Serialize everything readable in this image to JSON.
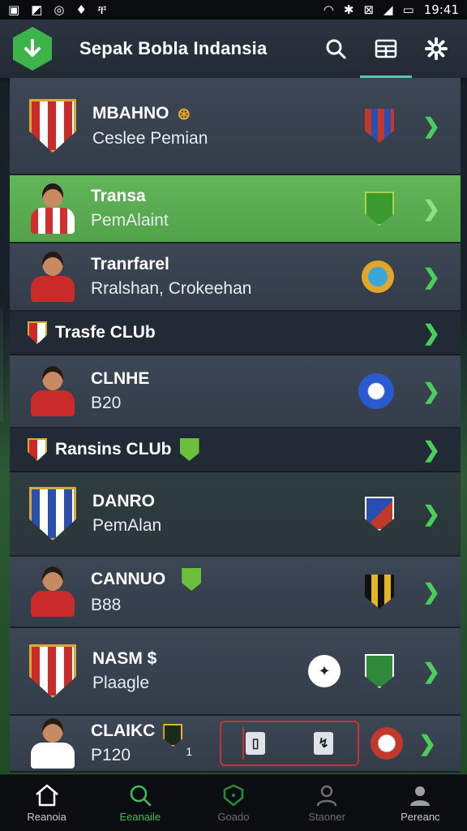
{
  "statusbar": {
    "time": "19:41"
  },
  "header": {
    "title": "Sepak Bobla Indansia",
    "actions": [
      "search-icon",
      "table-icon",
      "settings-icon"
    ]
  },
  "colors": {
    "accent": "#3cb44a",
    "highlight": "#5aac50",
    "chevron": "#4ccf5a",
    "danger": "#c83232"
  },
  "rows": [
    {
      "name": "MBAHNO",
      "sub": "Ceslee Pemian"
    },
    {
      "name": "Transa",
      "sub": "PemAlaint"
    },
    {
      "name": "Tranrfarel",
      "sub": "Rralshan, Crokeehan"
    }
  ],
  "section1": {
    "title": "Trasfe CLUb"
  },
  "row4": {
    "name": "CLNHE",
    "sub": "B20"
  },
  "section2": {
    "title": "Ransins CLUb"
  },
  "row5": {
    "name": "DANRO",
    "sub": "PemAlan"
  },
  "row6": {
    "name": "CANNUO",
    "sub": "B88"
  },
  "row7": {
    "name": "NASM $",
    "sub": "Plaagle"
  },
  "row8": {
    "name": "CLAIKC",
    "sub": "P120",
    "count": "1"
  },
  "nav": [
    {
      "label": "Reanoia"
    },
    {
      "label": "Eeanaile"
    },
    {
      "label": "Goado"
    },
    {
      "label": "Staoner"
    },
    {
      "label": "Pereanc"
    }
  ]
}
